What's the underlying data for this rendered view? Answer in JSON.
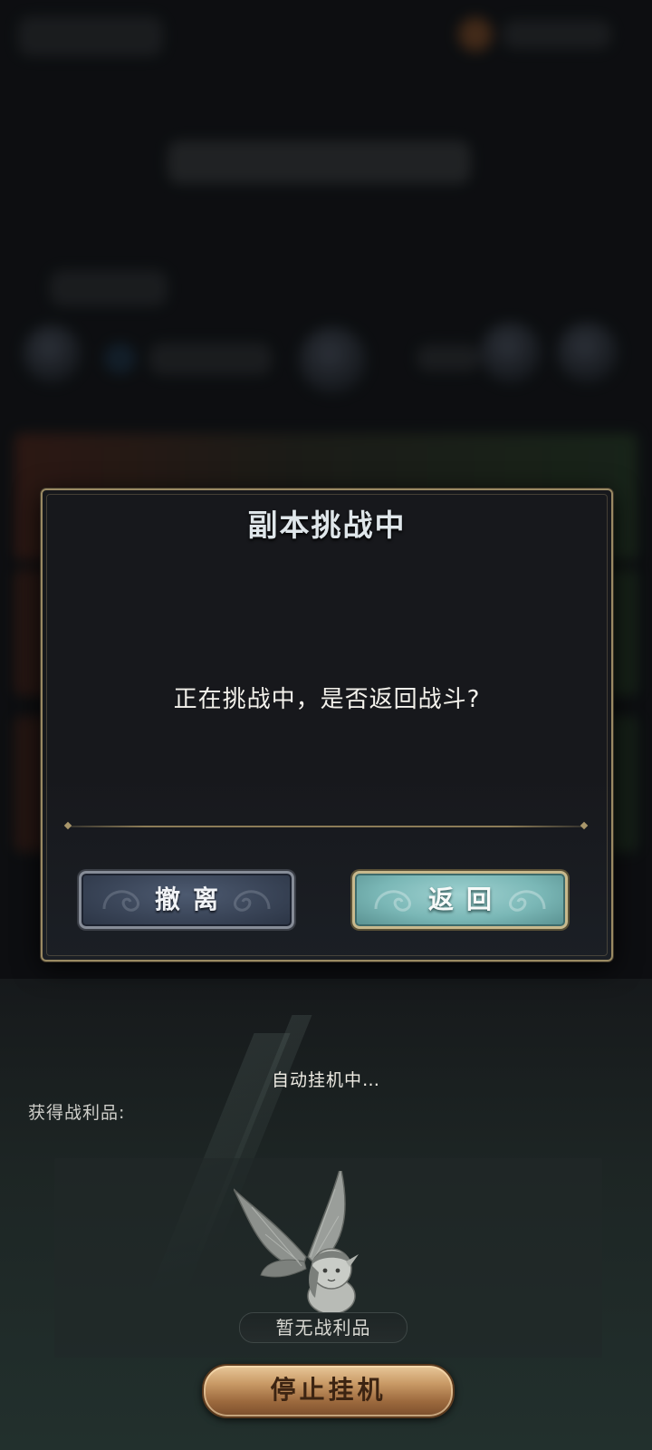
{
  "dialog": {
    "title": "副本挑战中",
    "message": "正在挑战中，是否返回战斗?",
    "leave_label": "撤离",
    "return_label": "返回"
  },
  "idle": {
    "status_text": "自动挂机中…",
    "loot_label": "获得战利品:",
    "empty_loot_text": "暂无战利品",
    "stop_label": "停止挂机"
  },
  "colors": {
    "dialog_border": "#9a8a63",
    "leave_button": "#3a4558",
    "return_button": "#7ab7b6",
    "stop_button": "#c99a66"
  }
}
